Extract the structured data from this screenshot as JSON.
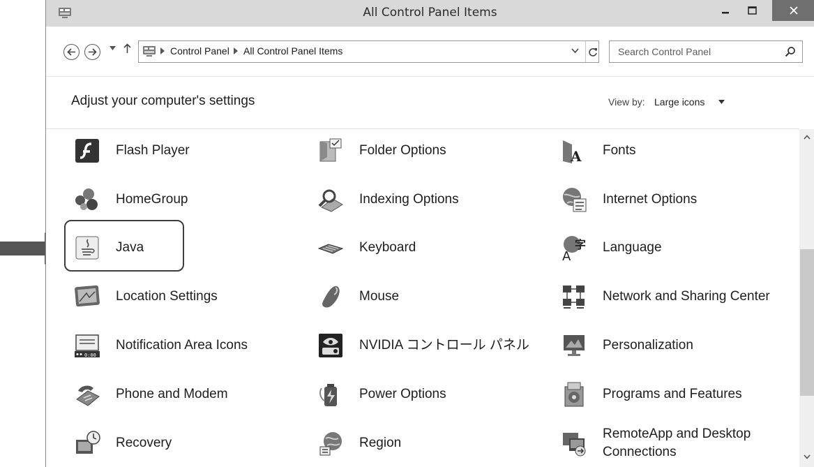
{
  "window": {
    "title": "All Control Panel Items"
  },
  "address": {
    "crumbs": [
      "Control Panel",
      "All Control Panel Items"
    ],
    "search_placeholder": "Search Control Panel"
  },
  "content": {
    "title": "Adjust your computer's settings",
    "view_by_label": "View by:",
    "view_by_value": "Large icons"
  },
  "items": [
    {
      "label": "Flash Player",
      "icon": "flash-player-icon"
    },
    {
      "label": "Folder Options",
      "icon": "folder-options-icon"
    },
    {
      "label": "Fonts",
      "icon": "fonts-icon"
    },
    {
      "label": "HomeGroup",
      "icon": "homegroup-icon"
    },
    {
      "label": "Indexing Options",
      "icon": "indexing-options-icon"
    },
    {
      "label": "Internet Options",
      "icon": "internet-options-icon"
    },
    {
      "label": "Java",
      "icon": "java-icon",
      "highlighted": true
    },
    {
      "label": "Keyboard",
      "icon": "keyboard-icon"
    },
    {
      "label": "Language",
      "icon": "language-icon"
    },
    {
      "label": "Location Settings",
      "icon": "location-settings-icon"
    },
    {
      "label": "Mouse",
      "icon": "mouse-icon"
    },
    {
      "label": "Network and Sharing Center",
      "icon": "network-sharing-icon"
    },
    {
      "label": "Notification Area Icons",
      "icon": "notification-area-icon"
    },
    {
      "label": "NVIDIA コントロール パネル",
      "icon": "nvidia-icon"
    },
    {
      "label": "Personalization",
      "icon": "personalization-icon"
    },
    {
      "label": "Phone and Modem",
      "icon": "phone-modem-icon"
    },
    {
      "label": "Power Options",
      "icon": "power-options-icon"
    },
    {
      "label": "Programs and Features",
      "icon": "programs-features-icon"
    },
    {
      "label": "Recovery",
      "icon": "recovery-icon"
    },
    {
      "label": "Region",
      "icon": "region-icon"
    },
    {
      "label": "RemoteApp and Desktop Connections",
      "icon": "remoteapp-icon"
    }
  ],
  "colors": {
    "titlebar": "#d9d9d9",
    "close_button": "#6f6f6f",
    "highlight_border": "#3d3d3d",
    "annotation_arrow": "#555555"
  }
}
